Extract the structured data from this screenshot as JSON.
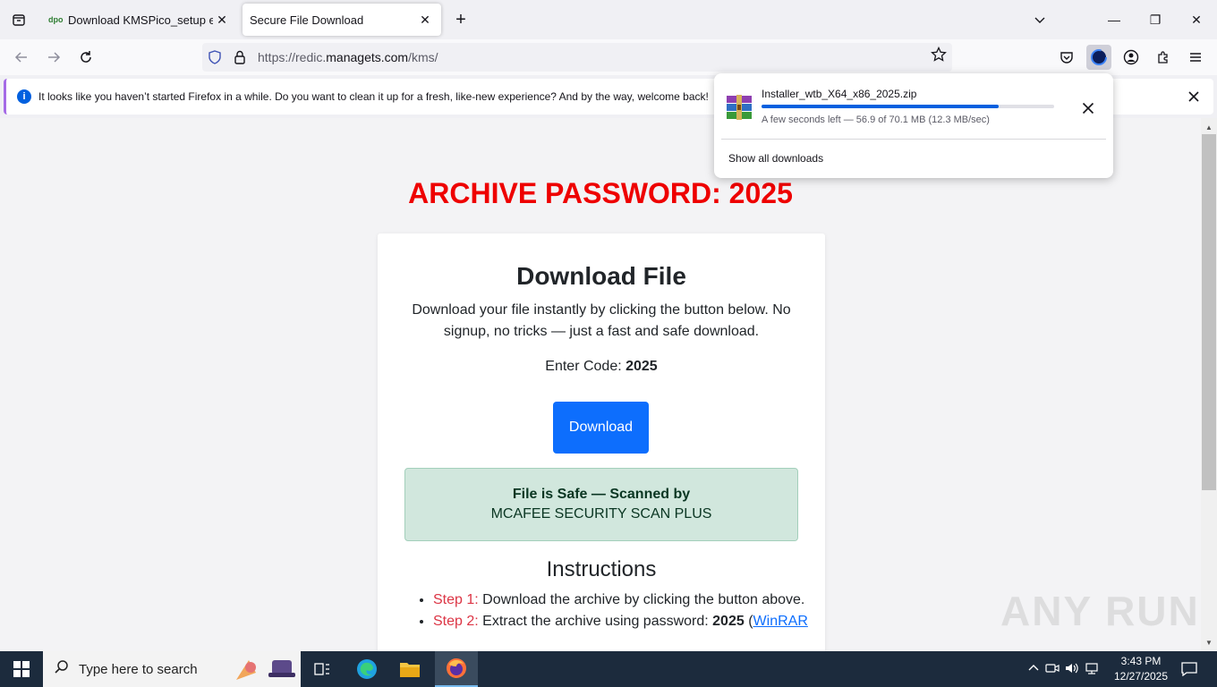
{
  "browser": {
    "tabs": [
      {
        "title": "Download KMSPico_setup exe \\",
        "favicon": "dpo"
      },
      {
        "title": "Secure File Download"
      }
    ],
    "url_prefix": "https://redic.",
    "url_domain": "managets.com",
    "url_suffix": "/kms/",
    "notification": "It looks like you haven’t started Firefox in a while. Do you want to clean it up for a fresh, like-new experience? And by the way, welcome back!"
  },
  "downloads": {
    "filename": "Installer_wtb_X64_x86_2025.zip",
    "progress": 0.81,
    "status": "A few seconds left — 56.9 of 70.1 MB (12.3 MB/sec)",
    "show_all": "Show all downloads"
  },
  "page": {
    "archive_password": "ARCHIVE PASSWORD: 2025",
    "title": "Download File",
    "description": "Download your file instantly by clicking the button below. No signup, no tricks — just a fast and safe download.",
    "code_label": "Enter Code: ",
    "code_value": "2025",
    "download_button": "Download",
    "safe_line1": "File is Safe — Scanned by",
    "safe_line2": "MCAFEE SECURITY SCAN PLUS",
    "instructions_title": "Instructions",
    "steps": [
      {
        "label": "Step 1:",
        "text": " Download the archive by clicking the button above."
      },
      {
        "label": "Step 2:",
        "text": " Extract the archive using password: ",
        "bold": "2025",
        "paren": " (",
        "link": "WinRAR"
      }
    ]
  },
  "watermark": "ANY RUN",
  "taskbar": {
    "search_placeholder": "Type here to search",
    "time": "3:43 PM",
    "date": "12/27/2025"
  },
  "colors": {
    "accent": "#0060df",
    "archive_red": "#ee0000",
    "button_blue": "#0d6efd",
    "safe_bg": "#d1e7dd",
    "taskbar": "#1c2b3d"
  }
}
